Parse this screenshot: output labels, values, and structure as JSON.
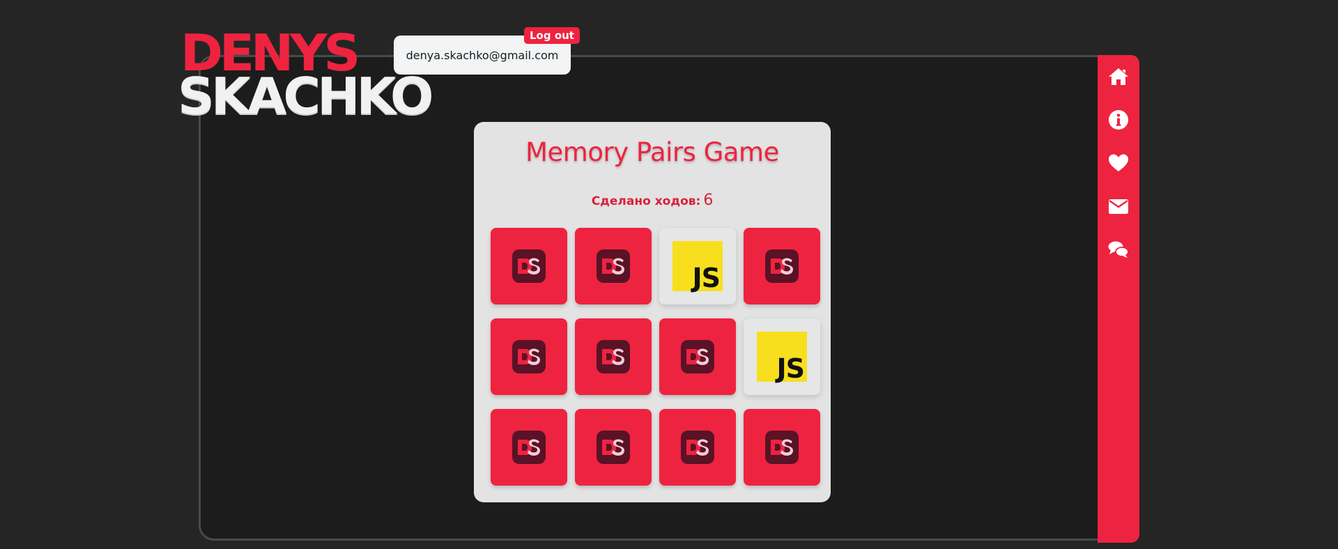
{
  "logo": {
    "line1": "DENYS",
    "line2": "SKACHKO"
  },
  "user": {
    "email": "denya.skachko@gmail.com",
    "logout_label": "Log out"
  },
  "sidebar": {
    "items": [
      {
        "icon": "home-icon"
      },
      {
        "icon": "info-icon"
      },
      {
        "icon": "heart-icon"
      },
      {
        "icon": "envelope-icon"
      },
      {
        "icon": "comments-icon"
      }
    ]
  },
  "game": {
    "title": "Memory Pairs Game",
    "moves_label": "Сделано ходов:",
    "moves_count": "6",
    "cards": [
      {
        "state": "face-down",
        "icon": "ds-logo-icon"
      },
      {
        "state": "face-down",
        "icon": "ds-logo-icon"
      },
      {
        "state": "face-up",
        "icon": "js-logo-icon",
        "text": "JS"
      },
      {
        "state": "face-down",
        "icon": "ds-logo-icon"
      },
      {
        "state": "face-down",
        "icon": "ds-logo-icon"
      },
      {
        "state": "face-down",
        "icon": "ds-logo-icon"
      },
      {
        "state": "face-down",
        "icon": "ds-logo-icon"
      },
      {
        "state": "face-up",
        "icon": "js-logo-icon",
        "text": "JS"
      },
      {
        "state": "face-down",
        "icon": "ds-logo-icon"
      },
      {
        "state": "face-down",
        "icon": "ds-logo-icon"
      },
      {
        "state": "face-down",
        "icon": "ds-logo-icon"
      },
      {
        "state": "face-down",
        "icon": "ds-logo-icon"
      }
    ]
  },
  "colors": {
    "accent": "#ee2340",
    "background": "#252525",
    "frame": "#1c1c1c",
    "card_panel": "#e2e3e2",
    "js_yellow": "#f7df1e"
  }
}
